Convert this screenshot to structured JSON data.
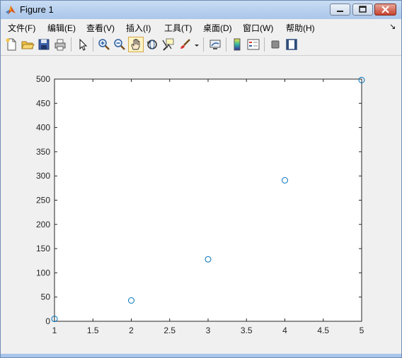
{
  "window": {
    "title": "Figure 1"
  },
  "menubar": {
    "items": [
      "文件(F)",
      "编辑(E)",
      "查看(V)",
      "插入(I)",
      "工具(T)",
      "桌面(D)",
      "窗口(W)",
      "帮助(H)"
    ]
  },
  "toolbar": {
    "icons": [
      "new-figure-icon",
      "open-file-icon",
      "save-icon",
      "print-icon",
      "pointer-icon",
      "zoom-in-icon",
      "zoom-out-icon",
      "pan-hand-icon",
      "rotate-3d-icon",
      "data-cursor-icon",
      "brush-icon",
      "link-plot-icon",
      "colorbar-icon",
      "legend-icon",
      "hide-plot-tools-icon",
      "show-plot-tools-icon"
    ],
    "active": "pan-hand-icon"
  },
  "colors": {
    "marker": "#0072bd",
    "axes_background": "#ffffff",
    "figure_background": "#f0f0f0"
  },
  "chart_data": {
    "type": "scatter",
    "x": [
      1,
      2,
      3,
      4,
      5
    ],
    "y": [
      5,
      43,
      128,
      291,
      498
    ],
    "marker": "circle-open",
    "xlim": [
      1,
      5
    ],
    "ylim": [
      0,
      500
    ],
    "xticks": [
      1,
      1.5,
      2,
      2.5,
      3,
      3.5,
      4,
      4.5,
      5
    ],
    "yticks": [
      0,
      50,
      100,
      150,
      200,
      250,
      300,
      350,
      400,
      450,
      500
    ],
    "xtick_labels": [
      "1",
      "1.5",
      "2",
      "2.5",
      "3",
      "3.5",
      "4",
      "4.5",
      "5"
    ],
    "ytick_labels": [
      "0",
      "50",
      "100",
      "150",
      "200",
      "250",
      "300",
      "350",
      "400",
      "450",
      "500"
    ],
    "title": "",
    "xlabel": "",
    "ylabel": "",
    "grid": false,
    "box": true
  }
}
